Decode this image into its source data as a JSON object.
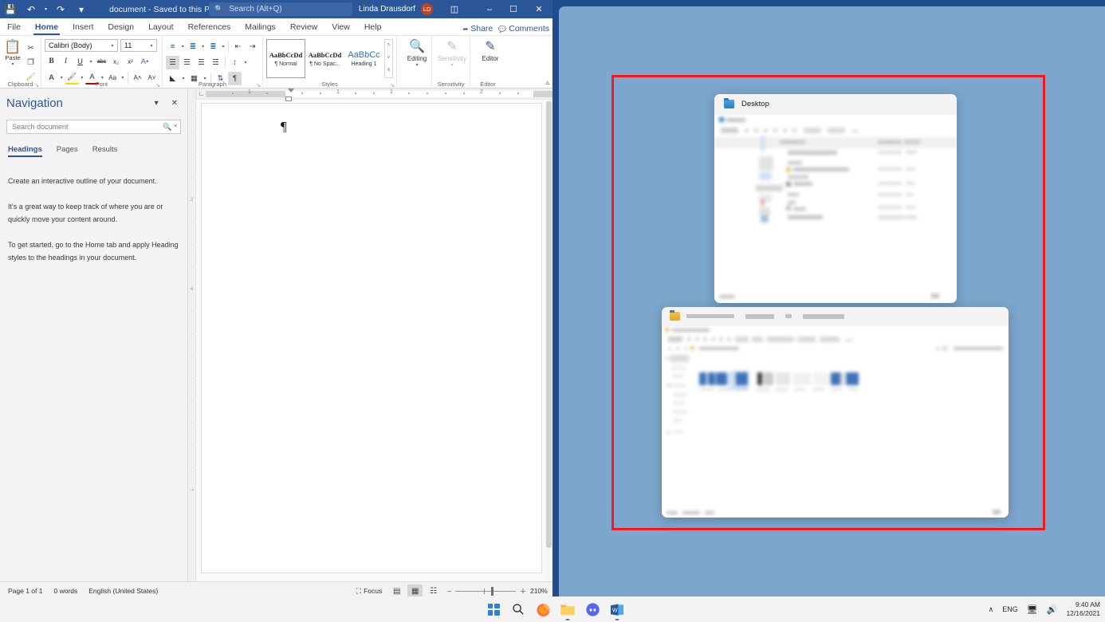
{
  "word": {
    "titlebar": {
      "save_icon": "save-icon",
      "undo_icon": "undo-icon",
      "redo_icon": "redo-icon",
      "qat_more_icon": "qat-overflow-icon",
      "doc_title": "document - Saved to this PC",
      "doc_title_caret": "▾",
      "search_placeholder": "Search (Alt+Q)",
      "search_icon": "search-icon",
      "user_name": "Linda Drausdorf",
      "user_initials": "LD",
      "ribbon_display_icon": "ribbon-display-options-icon",
      "minimize": "–",
      "maximize": "☐",
      "close": "✕"
    },
    "tabs": [
      {
        "label": "File",
        "active": false
      },
      {
        "label": "Home",
        "active": true
      },
      {
        "label": "Insert",
        "active": false
      },
      {
        "label": "Design",
        "active": false
      },
      {
        "label": "Layout",
        "active": false
      },
      {
        "label": "References",
        "active": false
      },
      {
        "label": "Mailings",
        "active": false
      },
      {
        "label": "Review",
        "active": false
      },
      {
        "label": "View",
        "active": false
      },
      {
        "label": "Help",
        "active": false
      }
    ],
    "tabs_right": [
      {
        "label": "Share",
        "icon": "share-icon"
      },
      {
        "label": "Comments",
        "icon": "comments-icon"
      }
    ],
    "ribbon": {
      "clipboard": {
        "group_label": "Clipboard",
        "paste_label": "Paste",
        "paste_icon": "paste-icon",
        "cut_icon": "cut-scissors-icon",
        "copy_icon": "copy-icon",
        "format_painter_icon": "format-painter-icon",
        "dialog_launcher": "↘"
      },
      "font": {
        "group_label": "Font",
        "font_family": "Calibri (Body)",
        "font_size": "11",
        "bold": "B",
        "italic": "I",
        "underline": "U",
        "strikethrough": "abc",
        "subscript": "x₂",
        "superscript": "x²",
        "text_effects_icon": "text-effects-icon",
        "text_highlight_icon": "text-highlight-color-icon",
        "font_color_icon": "font-color-icon",
        "change_case": "Aa",
        "grow_font": "A˄",
        "shrink_font": "A˅",
        "dialog_launcher": "↘"
      },
      "paragraph": {
        "group_label": "Paragraph",
        "bullets_icon": "bullets-icon",
        "numbering_icon": "numbering-icon",
        "multilevel_icon": "multilevel-list-icon",
        "decrease_indent_icon": "decrease-indent-icon",
        "increase_indent_icon": "increase-indent-icon",
        "align_left_icon": "align-left-icon",
        "align_center_icon": "align-center-icon",
        "align_right_icon": "align-right-icon",
        "justify_icon": "justify-icon",
        "line_spacing_icon": "line-spacing-icon",
        "shading_icon": "shading-icon",
        "borders_icon": "borders-icon",
        "sort_icon": "sort-icon",
        "show_marks_icon": "show-formatting-marks-icon",
        "dialog_launcher": "↘"
      },
      "styles": {
        "group_label": "Styles",
        "items": [
          {
            "preview": "AaBbCcDd",
            "name": "¶ Normal",
            "selected": true
          },
          {
            "preview": "AaBbCcDd",
            "name": "¶ No Spac...",
            "selected": false
          },
          {
            "preview": "AaBbCc",
            "name": "Heading 1",
            "selected": false
          }
        ],
        "scroll_up": "˄",
        "scroll_down": "˅",
        "more": "≡",
        "dialog_launcher": "↘"
      },
      "editing": {
        "group_label": "",
        "label": "Editing",
        "icon": "find-magnifier-icon",
        "caret": "˅"
      },
      "sensitivity": {
        "group_label": "Sensitivity",
        "label": "Sensitivity",
        "icon": "sensitivity-icon",
        "caret": "˅",
        "disabled": true
      },
      "editor": {
        "group_label": "Editor",
        "label": "Editor",
        "icon": "editor-pen-icon"
      },
      "collapse_icon": "collapse-ribbon-icon"
    },
    "navigation": {
      "title": "Navigation",
      "dropdown_icon": "▾",
      "close_icon": "✕",
      "search_placeholder": "Search document",
      "search_icon": "search-icon",
      "search_caret": "˅",
      "tabs": [
        {
          "label": "Headings",
          "active": true
        },
        {
          "label": "Pages",
          "active": false
        },
        {
          "label": "Results",
          "active": false
        }
      ],
      "paragraphs": [
        "Create an interactive outline of your document.",
        "It's a great way to keep track of where you are or quickly move your content around.",
        "To get started, go to the Home tab and apply Heading styles to the headings in your document."
      ]
    },
    "document": {
      "pilcrow": "¶",
      "ruler_numbers": [
        "1",
        "1",
        "2"
      ],
      "tab_stop_icon": "left-tab-stop-icon"
    },
    "statusbar": {
      "page": "Page 1 of 1",
      "words": "0 words",
      "language": "English (United States)",
      "focus_label": "Focus",
      "focus_icon": "focus-mode-icon",
      "read_mode_icon": "read-mode-icon",
      "print_layout_icon": "print-layout-icon",
      "web_layout_icon": "web-layout-icon",
      "zoom_out": "–",
      "zoom_in": "＋",
      "zoom_level": "210%"
    }
  },
  "desktop": {
    "background_color": "#7ca6cd",
    "highlight_color": "#f01c1c",
    "windows": [
      {
        "name": "desktop-explorer-window",
        "title": "Desktop",
        "icon": "folder-icon"
      },
      {
        "name": "files-explorer-window",
        "title": "",
        "icon": "folder-icon"
      }
    ]
  },
  "taskbar": {
    "apps": [
      {
        "name": "start-button",
        "icon": "windows-logo-icon",
        "running": false
      },
      {
        "name": "taskbar-search",
        "icon": "search-icon",
        "running": false
      },
      {
        "name": "taskbar-firefox",
        "icon": "firefox-icon",
        "running": false
      },
      {
        "name": "taskbar-file-explorer",
        "icon": "file-explorer-icon",
        "running": true
      },
      {
        "name": "taskbar-discord",
        "icon": "discord-icon",
        "running": false
      },
      {
        "name": "taskbar-word",
        "icon": "word-icon",
        "running": true
      }
    ],
    "tray": {
      "overflow_icon": "∧",
      "language": "ENG",
      "network_icon": "network-icon",
      "volume_icon": "volume-icon",
      "time": "9:40 AM",
      "date": "12/16/2021"
    }
  }
}
